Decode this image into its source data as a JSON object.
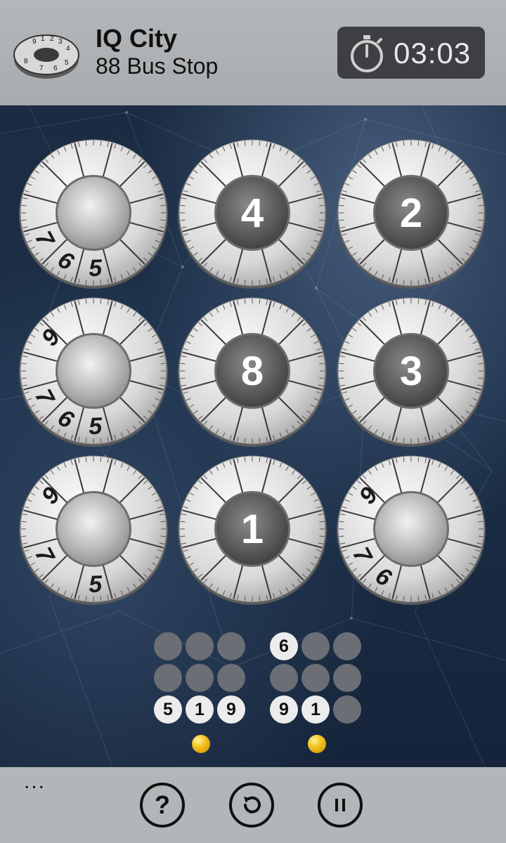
{
  "header": {
    "app_name": "IQ City",
    "level_name": "88 Bus Stop",
    "timer": "03:03"
  },
  "dials": [
    {
      "center": "",
      "rim": [
        {
          "n": "7",
          "slot": "r7"
        },
        {
          "n": "6",
          "slot": "r6"
        },
        {
          "n": "5",
          "slot": "r5"
        }
      ]
    },
    {
      "center": "4",
      "rim": []
    },
    {
      "center": "2",
      "rim": []
    },
    {
      "center": "",
      "rim": [
        {
          "n": "9",
          "slot": "r9"
        },
        {
          "n": "7",
          "slot": "r7"
        },
        {
          "n": "6",
          "slot": "r6"
        },
        {
          "n": "5",
          "slot": "r5"
        }
      ]
    },
    {
      "center": "8",
      "rim": []
    },
    {
      "center": "3",
      "rim": []
    },
    {
      "center": "",
      "rim": [
        {
          "n": "9",
          "slot": "r9"
        },
        {
          "n": "7",
          "slot": "r7"
        },
        {
          "n": "5",
          "slot": "r5"
        }
      ]
    },
    {
      "center": "1",
      "rim": []
    },
    {
      "center": "",
      "rim": [
        {
          "n": "9",
          "slot": "r9"
        },
        {
          "n": "7",
          "slot": "r7"
        },
        {
          "n": "6",
          "slot": "r6"
        }
      ]
    }
  ],
  "mini_grids": [
    {
      "cells": [
        "",
        "",
        "",
        "",
        "",
        "",
        "5",
        "1",
        "9"
      ]
    },
    {
      "cells": [
        "6",
        "",
        "",
        "",
        "",
        "",
        "9",
        "1",
        ""
      ]
    }
  ],
  "appbar": {
    "more": "...",
    "help_label": "?"
  }
}
